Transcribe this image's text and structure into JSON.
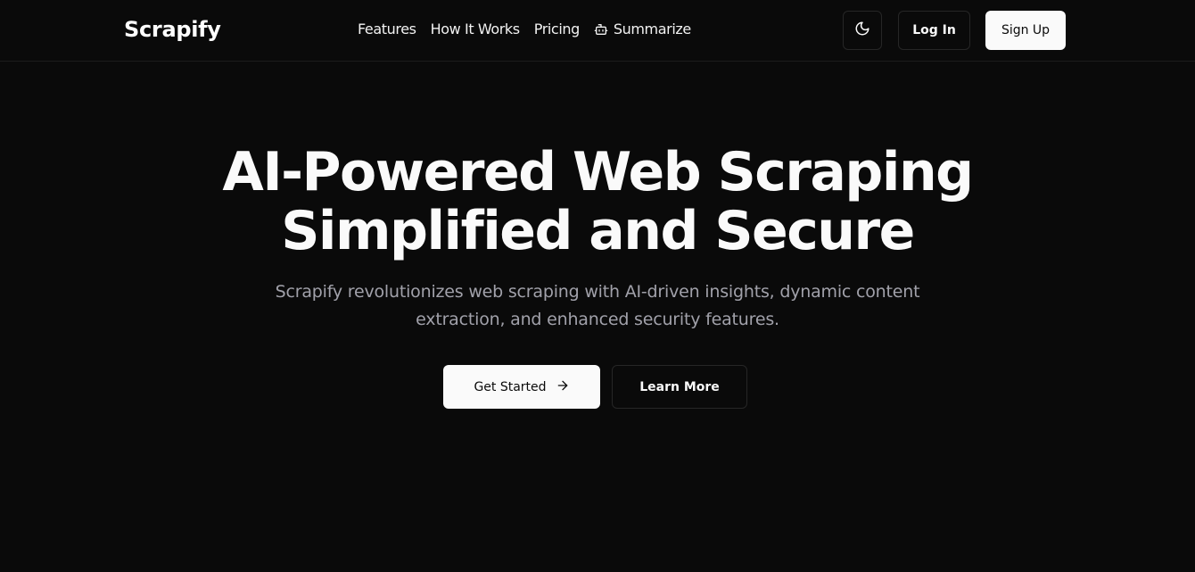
{
  "brand": {
    "name": "Scrapify"
  },
  "nav": {
    "links": [
      {
        "label": "Features"
      },
      {
        "label": "How It Works"
      },
      {
        "label": "Pricing"
      },
      {
        "label": "Summarize",
        "icon": "bot-icon"
      }
    ],
    "theme_toggle_icon": "moon-icon",
    "login_label": "Log In",
    "signup_label": "Sign Up"
  },
  "hero": {
    "title_line1": "AI-Powered Web Scraping",
    "title_line2": "Simplified and Secure",
    "subtitle": "Scrapify revolutionizes web scraping with AI-driven insights, dynamic content extraction, and enhanced security features.",
    "primary_cta": "Get Started",
    "primary_cta_icon": "arrow-right-icon",
    "secondary_cta": "Learn More"
  },
  "colors": {
    "background": "#0a0a0a",
    "foreground": "#fafafa",
    "muted_text": "#a1a1aa",
    "border": "#262626"
  }
}
